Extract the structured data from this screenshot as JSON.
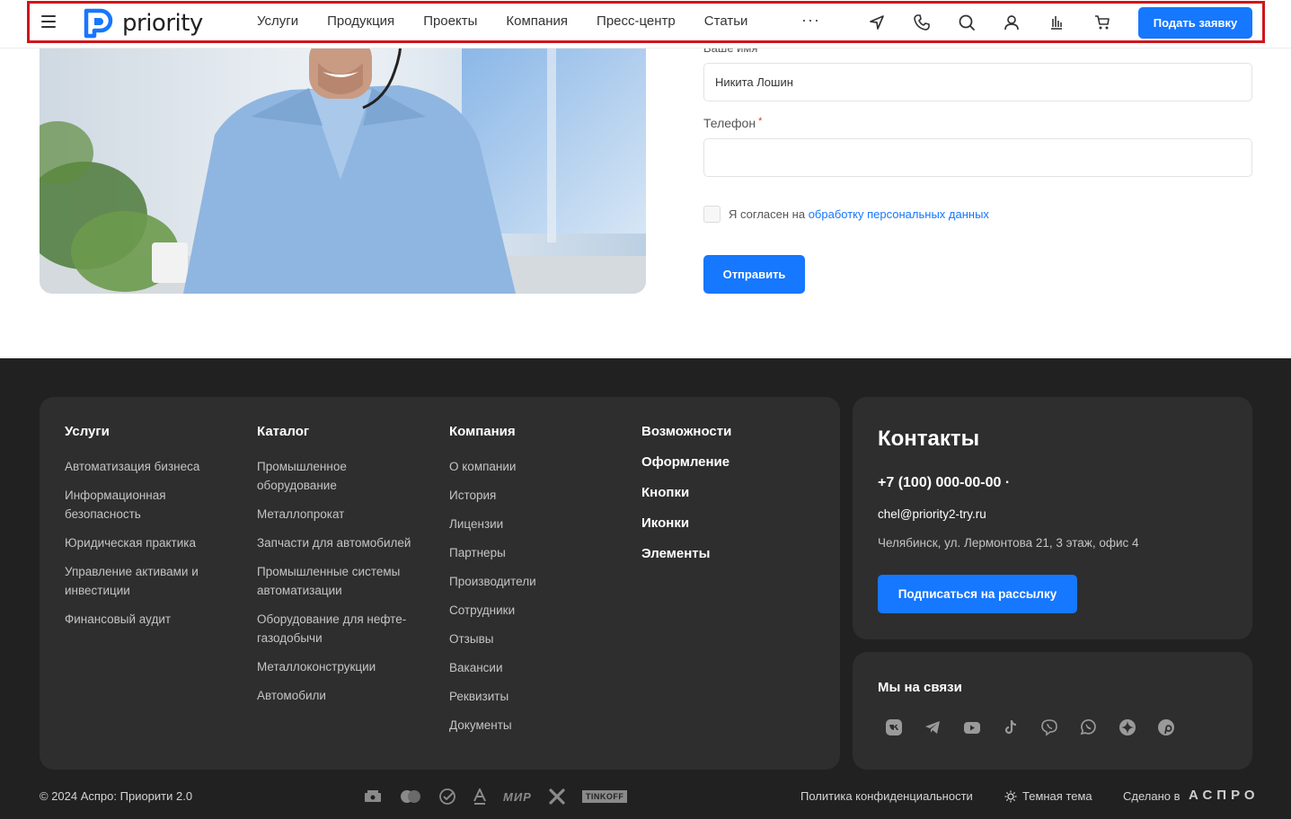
{
  "header": {
    "logo_text": "priority",
    "nav": [
      "Услуги",
      "Продукция",
      "Проекты",
      "Компания",
      "Пресс-центр",
      "Статьи"
    ],
    "more_label": "···",
    "cta_label": "Подать заявку",
    "icons": [
      "location-arrow-icon",
      "phone-icon",
      "search-icon",
      "user-icon",
      "chart-icon",
      "cart-icon"
    ],
    "accent_color": "#1677ff"
  },
  "form": {
    "name_label_cut": "Ваше имя",
    "name_value": "Никита Лошин",
    "phone_label": "Телефон",
    "required_mark": "*",
    "consent_prefix": "Я согласен на",
    "consent_link": "обработку персональных данных",
    "submit_label": "Отправить"
  },
  "footer": {
    "services": {
      "title": "Услуги",
      "items": [
        "Автоматизация бизнеса",
        "Информационная безопасность",
        "Юридическая практика",
        "Управление активами и инвестиции",
        "Финансовый аудит"
      ]
    },
    "catalog": {
      "title": "Каталог",
      "items": [
        "Промышленное оборудование",
        "Металлопрокат",
        "Запчасти для автомобилей",
        "Промышленные системы автоматизации",
        "Оборудование для нефте-газодобычи",
        "Металлоконструкции",
        "Автомобили"
      ]
    },
    "company": {
      "title": "Компания",
      "items": [
        "О компании",
        "История",
        "Лицензии",
        "Партнеры",
        "Производители",
        "Сотрудники",
        "Отзывы",
        "Вакансии",
        "Реквизиты",
        "Документы"
      ]
    },
    "features": {
      "items": [
        "Возможности",
        "Оформление",
        "Кнопки",
        "Иконки",
        "Элементы"
      ]
    },
    "contacts": {
      "title": "Контакты",
      "phone": "+7 (100) 000-00-00 ·",
      "email": "chel@priority2-try.ru",
      "address": "Челябинск, ул. Лермонтова 21, 3 этаж, офис 4",
      "subscribe_label": "Подписаться на рассылку"
    },
    "social": {
      "title": "Мы на связи",
      "icons": [
        "vk-icon",
        "telegram-icon",
        "youtube-icon",
        "tiktok-icon",
        "viber-icon",
        "whatsapp-icon",
        "dzen-icon",
        "pinterest-icon"
      ]
    },
    "copyright": "© 2024 Аспро: Приорити 2.0",
    "payment_icons": [
      "cash-icon",
      "mastercard-icon",
      "sbp-check-icon",
      "alfabank-icon",
      "mir-icon",
      "x-icon",
      "tinkoff-icon"
    ],
    "mir_text": "МИР",
    "tinkoff_text": "TINKOFF",
    "privacy": "Политика конфиденциальности",
    "theme": "Темная тема",
    "made_in": "Сделано в",
    "made_by": "АСПРО"
  }
}
